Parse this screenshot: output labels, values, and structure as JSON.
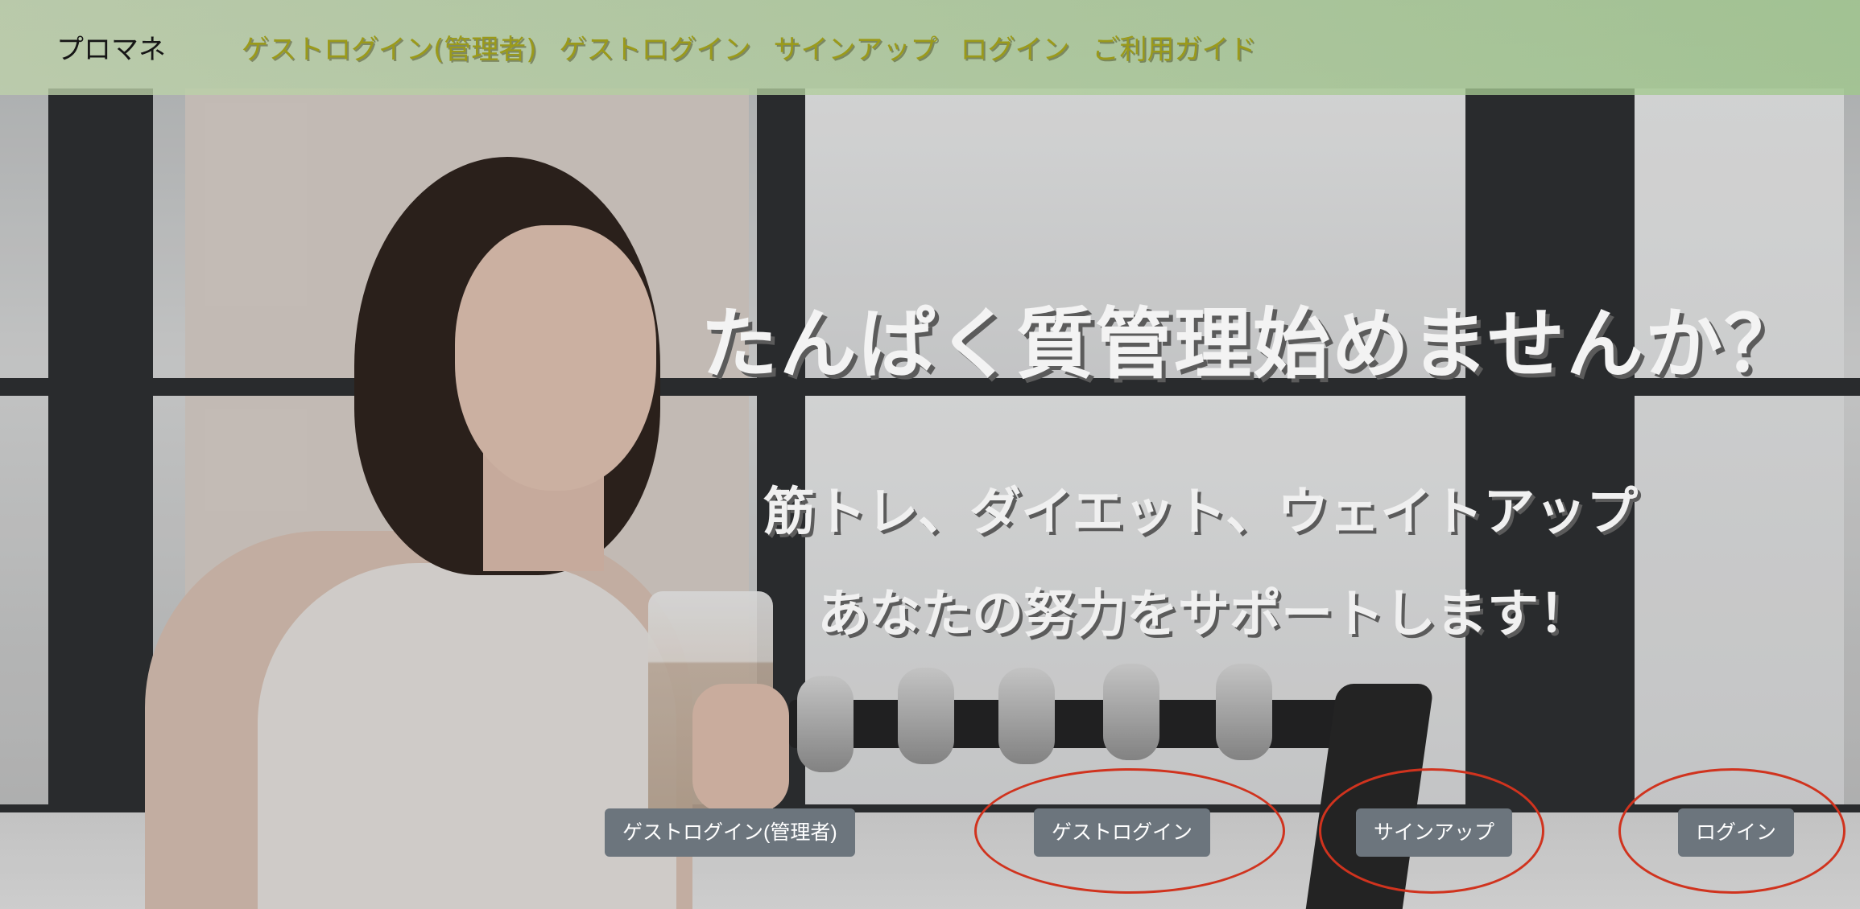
{
  "navbar": {
    "brand": "プロマネ",
    "links": [
      {
        "label": "ゲストログイン(管理者)"
      },
      {
        "label": "ゲストログイン"
      },
      {
        "label": "サインアップ"
      },
      {
        "label": "ログイン"
      },
      {
        "label": "ご利用ガイド"
      }
    ]
  },
  "hero": {
    "headline": "たんぱく質管理始めませんか？",
    "subline_1": "筋トレ、ダイエット、ウェイトアップ",
    "subline_2": "あなたの努力をサポートします！"
  },
  "buttons": {
    "guest_admin": "ゲストログイン(管理者)",
    "guest": "ゲストログイン",
    "signup": "サインアップ",
    "login": "ログイン"
  },
  "colors": {
    "navbar_bg": "#a8cc98",
    "button_bg": "#6c757d",
    "annotation_ring": "#d0331e"
  }
}
